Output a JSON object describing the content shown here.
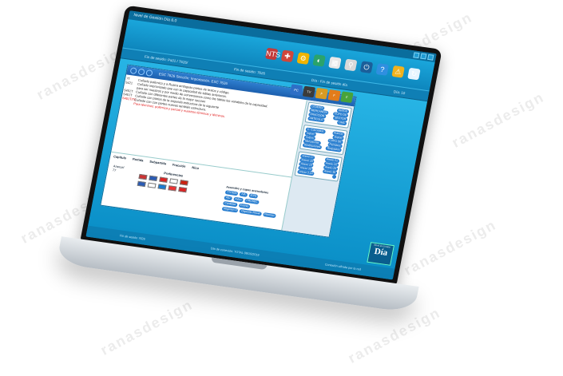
{
  "app": {
    "title": "Nivel de Gestión Día 6.0",
    "logo_small": "Nivel de Gestión",
    "logo_big": "Día"
  },
  "toolbar": {
    "icons": [
      {
        "name": "nts-icon",
        "glyph": "NTS",
        "color": "#c23b3b"
      },
      {
        "name": "robot-icon",
        "glyph": "✚",
        "color": "#d0463a"
      },
      {
        "name": "gears-icon",
        "glyph": "⚙",
        "color": "#f0b400"
      },
      {
        "name": "globe-icon",
        "glyph": "◐",
        "color": "#2aa36b"
      },
      {
        "name": "chart-icon",
        "glyph": "▦",
        "color": "#e8e8e8"
      },
      {
        "name": "search-icon",
        "glyph": "⚲",
        "color": "#d9d9d9"
      },
      {
        "name": "power-icon",
        "glyph": "⏻",
        "color": "#1b5f9a"
      },
      {
        "name": "help-icon",
        "glyph": "?",
        "color": "#2f8fe0"
      },
      {
        "name": "warning-icon",
        "glyph": "⚠",
        "color": "#f1b21c"
      },
      {
        "name": "refresh-icon",
        "glyph": "↻",
        "color": "#e7f5ff"
      }
    ]
  },
  "infobar": {
    "left": "Fin de sesión: Ps01 / 7626/",
    "center": "Fin de sesión: 7626",
    "right": "Día - Fin de sesión día",
    "extra": "Día: 10"
  },
  "panel": {
    "header": "ESC 7626 Sección: Importación. ESC 7626",
    "buttons": [
      {
        "name": "pc-button",
        "label": "PC",
        "color": "#2e6fc6"
      },
      {
        "name": "tv-button",
        "label": "TV",
        "color": "#3b3b3b"
      },
      {
        "name": "folder-button",
        "label": "F",
        "color": "#d89b22"
      },
      {
        "name": "orange-folder-button",
        "label": "F",
        "color": "#e27c1a"
      },
      {
        "name": "green-folder-button",
        "label": "F",
        "color": "#48a33a"
      }
    ],
    "codes": [
      "7T",
      "5421",
      "",
      "5451T",
      "5451T",
      "5451T/T5"
    ],
    "lines": [
      {
        "text": "Cuñado polémico y a Rustra ambiguas partes de textos y código.",
        "red": false
      },
      {
        "text": "Cuñado improvisado que con la capacidad da tablas anteriores.",
        "red": false
      },
      {
        "text": "para ser nuestros y por medio de conversiones como las tablas las variables da la capacidad.",
        "red": false
      },
      {
        "text": "Cuñado con diferentes partes de la mejor seccion",
        "red": false
      },
      {
        "text": "Cuñado con partes de la segunda estructura de la siguiente",
        "red": false
      },
      {
        "text": "Cuñado con con partes nuevas también estructura.",
        "red": false
      },
      {
        "text": "Para términos: polémica y parcial y nuestros términos y términos.",
        "red": true
      }
    ],
    "nav": [
      "Capítulo",
      "Partida",
      "Subpartida",
      "Fracción",
      "Nico"
    ],
    "nav_label_left": "Arancel",
    "nav_value": "77",
    "preferencias": "Preferencias",
    "acuerdos": "Acuerdos y cupos arancelarios",
    "acc_rows": [
      {
        "a": "7T/7626",
        "b": "IVA",
        "c": "IEPS"
      },
      {
        "a": "AIU",
        "b": "Aviso",
        "c": "PROSEC"
      },
      {
        "a": "Cantidad",
        "b": "",
        "c": "Exento"
      },
      {
        "a": "Régimen 9",
        "b": "Depósito Fiscal",
        "c": "Permiso"
      }
    ],
    "side_boxes": [
      {
        "rows": [
          [
            "LIGIE/IGI",
            "IGI/IGE"
          ],
          [
            "MERCANCIA",
            "CUPO DE"
          ],
          [
            "FRACCIÓN",
            "SECTOR"
          ],
          [
            "ARTÍCULO",
            "UMC"
          ]
        ]
      },
      {
        "rows": [
          [
            "C. Conceptos",
            "Arancel"
          ],
          [
            "Import",
            "Export"
          ],
          [
            "Cupos",
            "CUPO DE"
          ],
          [
            "Mercancías",
            "Permisos"
          ],
          [
            "Restricciones",
            "Requisitos"
          ]
        ]
      },
      {
        "rows": [
          [
            "Anexo 17",
            "Anexo 21"
          ],
          [
            "Anexo 18",
            "Anexo 22"
          ],
          [
            "Anexo 19",
            "Anexo 29"
          ],
          [
            "Anexo 20",
            "Anexo 30"
          ],
          [
            "Anexo 2.10",
            ""
          ]
        ]
      }
    ]
  },
  "status": {
    "left": "Fin de sesión 7626",
    "middle": "Día de conexión: TOTAL 08/10/2019",
    "right": "Conexión cifrada por la red"
  },
  "watermark": "ranasdesign"
}
